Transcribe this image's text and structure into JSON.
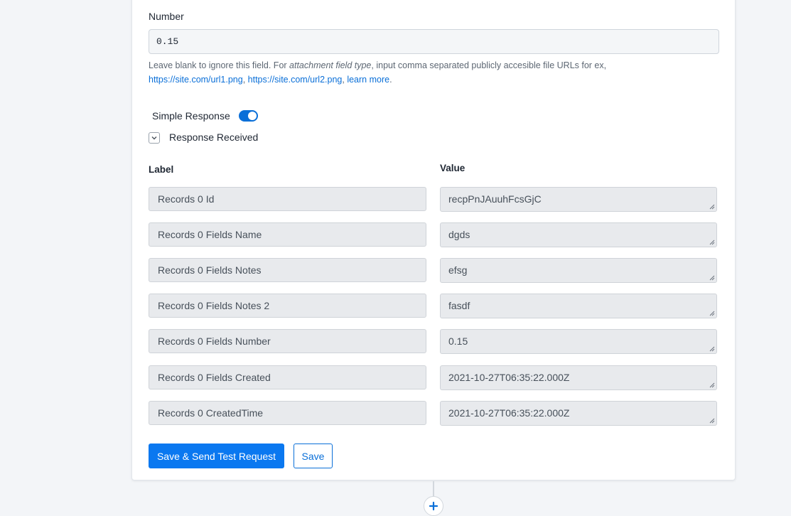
{
  "field": {
    "label": "Number",
    "value": "0.15",
    "help_prefix": "Leave blank to ignore this field. For ",
    "help_em": "attachment field type",
    "help_mid": ", input comma separated publicly accesible file URLs for ex,",
    "help_link1": "https://site.com/url1.png",
    "help_sep": ", ",
    "help_link2": "https://site.com/url2.png",
    "help_sep2": ", ",
    "help_link3": "learn more",
    "help_end": "."
  },
  "simple_response": {
    "label": "Simple Response",
    "enabled": true
  },
  "response": {
    "label": "Response Received"
  },
  "table": {
    "label_header": "Label",
    "value_header": "Value",
    "rows": [
      {
        "label": "Records 0 Id",
        "value": "recpPnJAuuhFcsGjC"
      },
      {
        "label": "Records 0 Fields Name",
        "value": "dgds"
      },
      {
        "label": "Records 0 Fields Notes",
        "value": "efsg"
      },
      {
        "label": "Records 0 Fields Notes 2",
        "value": "fasdf"
      },
      {
        "label": "Records 0 Fields Number",
        "value": "0.15"
      },
      {
        "label": "Records 0 Fields Created",
        "value": "2021-10-27T06:35:22.000Z"
      },
      {
        "label": "Records 0 CreatedTime",
        "value": "2021-10-27T06:35:22.000Z"
      }
    ]
  },
  "buttons": {
    "save_send": "Save & Send Test Request",
    "save": "Save"
  },
  "colors": {
    "accent": "#0a78f0",
    "link": "#0a6fd8",
    "background": "#f3f5f8"
  }
}
